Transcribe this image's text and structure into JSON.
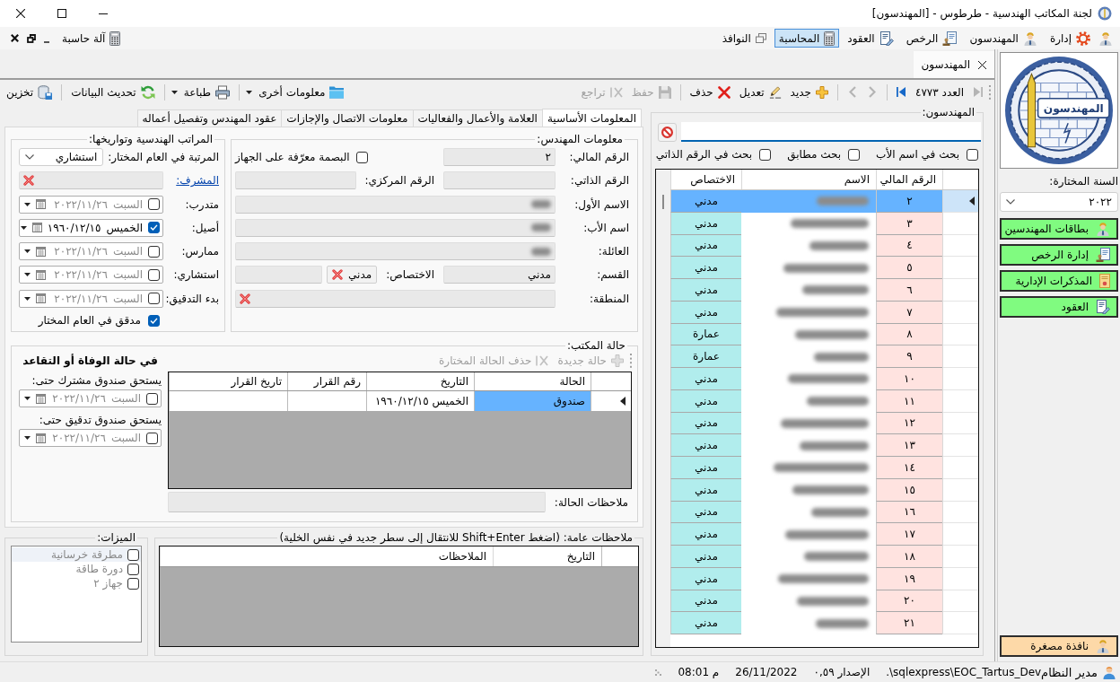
{
  "window": {
    "title": "لجنة المكاتب الهندسية - طرطوس - [المهندسون]"
  },
  "menu": {
    "items": [
      {
        "kind": "admin",
        "label": "إدارة",
        "selected": false
      },
      {
        "kind": "engineers",
        "label": "المهندسون",
        "selected": false
      },
      {
        "kind": "licenses",
        "label": "الرخص",
        "selected": false
      },
      {
        "kind": "contracts",
        "label": "العقود",
        "selected": false
      },
      {
        "kind": "accounting",
        "label": "المحاسبة",
        "selected": true
      },
      {
        "kind": "windows",
        "label": "النوافذ",
        "selected": false
      }
    ],
    "calculator": {
      "label": "آلة حاسبة"
    }
  },
  "document_tabs": [
    {
      "label": "المهندسون",
      "selected": true
    }
  ],
  "record_toolbar": {
    "first": {
      "disabled": true
    },
    "count": "العدد ٤٧٧٣",
    "last": {
      "disabled": false
    },
    "previous": {
      "disabled": true
    },
    "next": {
      "disabled": true
    },
    "action_groups": [
      [
        {
          "kind": "new",
          "label": "جديد",
          "disabled": false
        },
        {
          "kind": "edit",
          "label": "تعديل",
          "disabled": false
        },
        {
          "kind": "delete",
          "label": "حذف",
          "disabled": false
        }
      ],
      [
        {
          "kind": "save",
          "label": "حفظ",
          "disabled": true
        },
        {
          "kind": "undo",
          "label": "تراجع",
          "disabled": true
        }
      ]
    ]
  },
  "tools_toolbar": [
    {
      "kind": "other_info",
      "label": "معلومات أخرى",
      "dropdown": true
    },
    {
      "kind": "print",
      "label": "طباعة",
      "dropdown": true
    },
    {
      "kind": "refresh",
      "label": "تحديث البيانات",
      "dropdown": false
    },
    {
      "kind": "store",
      "label": "تخزين",
      "dropdown": false
    }
  ],
  "form_tabs": [
    {
      "label": "المعلومات الأساسية",
      "selected": true
    },
    {
      "label": "العلامة والأعمال والفعاليات",
      "selected": false
    },
    {
      "label": "معلومات الاتصال والإجازات",
      "selected": false
    },
    {
      "label": "عقود المهندس وتفصيل أعماله",
      "selected": false
    }
  ],
  "engineer_info": {
    "title": "معلومات المهندس:",
    "financial_number": {
      "label": "الرقم المالي:",
      "value": "٢"
    },
    "fingerprint": {
      "label": "البصمة معرّفة على الجهاز",
      "checked": false
    },
    "personal_number": {
      "label": "الرقم الذاتي:"
    },
    "central_number": {
      "label": "الرقم المركزي:"
    },
    "first_name": {
      "label": "الاسم الأول:",
      "blurred": true
    },
    "father_name": {
      "label": "اسم الأب:",
      "blurred": true
    },
    "family_name": {
      "label": "العائلة:",
      "blurred": true
    },
    "department": {
      "label": "القسم:",
      "value": "مدني"
    },
    "specialty": {
      "label": "الاختصاص:",
      "value": "مدني"
    },
    "region": {
      "label": "المنطقة:"
    }
  },
  "ranks": {
    "title": "المراتب الهندسية وتواريخها:",
    "rank": {
      "label": "المرتبة في العام المختار:",
      "value": "استشاري"
    },
    "supervisor": {
      "label": "المشرف:"
    },
    "dates": [
      {
        "label": "متدرب:",
        "checked": false,
        "day": "السبت",
        "date": "٢٠٢٢/١١/٢٦"
      },
      {
        "label": "أصيل:",
        "checked": true,
        "day": "الخميس",
        "date": "١٩٦٠/١٢/١٥"
      },
      {
        "label": "ممارس:",
        "checked": false,
        "day": "السبت",
        "date": "٢٠٢٢/١١/٢٦"
      },
      {
        "label": "استشاري:",
        "checked": false,
        "day": "السبت",
        "date": "٢٠٢٢/١١/٢٦"
      },
      {
        "label": "بدء التدقيق:",
        "checked": false,
        "day": "السبت",
        "date": "٢٠٢٢/١١/٢٦"
      }
    ],
    "auditor": {
      "label": "مدقق في العام المختار",
      "checked": true
    }
  },
  "office_status": {
    "title": "حالة المكتب:",
    "retirement_note": "في حالة الوفاة أو التقاعد",
    "funds": [
      {
        "label": "يستحق صندوق مشترك حتى:",
        "checked": false,
        "day": "السبت",
        "date": "٢٠٢٢/١١/٢٦"
      },
      {
        "label": "يستحق صندوق تدقيق حتى:",
        "checked": false,
        "day": "السبت",
        "date": "٢٠٢٢/١١/٢٦"
      }
    ],
    "toolbar": [
      {
        "kind": "add",
        "label": "حالة جديدة",
        "disabled": true
      },
      {
        "kind": "delete",
        "label": "حذف الحالة المختارة",
        "disabled": true
      }
    ],
    "table": {
      "columns": [
        "الحالة",
        "التاريخ",
        "رقم القرار",
        "تاريخ القرار"
      ],
      "rows": [
        {
          "status": "صندوق",
          "date": "الخميس ١٩٦٠/١٢/١٥",
          "selected": true
        }
      ]
    },
    "notes": {
      "label": "ملاحظات الحالة:"
    }
  },
  "features": {
    "title": "الميزات:",
    "items": [
      {
        "label": "مطرقة خرسانية",
        "checked": false,
        "selected": true,
        "disabled": true
      },
      {
        "label": "دورة طاقة",
        "checked": false,
        "selected": false,
        "disabled": true
      },
      {
        "label": "جهاز ٢",
        "checked": false,
        "selected": false,
        "disabled": true
      }
    ]
  },
  "general_notes": {
    "title": "ملاحظات عامة: (اضغط Shift+Enter للانتقال إلى سطر جديد في نفس الخلية)",
    "columns": [
      "التاريخ",
      "الملاحظات"
    ]
  },
  "engineers": {
    "title": "المهندسون:",
    "options": [
      {
        "label": "بحث في اسم الأب",
        "checked": false
      },
      {
        "label": "بحث مطابق",
        "checked": false
      },
      {
        "label": "بحث في الرقم الذاتي",
        "checked": false
      }
    ],
    "table": {
      "columns": [
        {
          "label": "الرقم المالي"
        },
        {
          "label": "الاسم",
          "blurred": true
        },
        {
          "label": "الاختصاص"
        }
      ],
      "rows": [
        {
          "number": "٢",
          "specialty": "مدني",
          "selected": true
        },
        {
          "number": "٣",
          "specialty": "مدني",
          "selected": false
        },
        {
          "number": "٤",
          "specialty": "مدني",
          "selected": false
        },
        {
          "number": "٥",
          "specialty": "مدني",
          "selected": false
        },
        {
          "number": "٦",
          "specialty": "مدني",
          "selected": false
        },
        {
          "number": "٧",
          "specialty": "مدني",
          "selected": false
        },
        {
          "number": "٨",
          "specialty": "عمارة",
          "selected": false
        },
        {
          "number": "٩",
          "specialty": "عمارة",
          "selected": false
        },
        {
          "number": "١٠",
          "specialty": "مدني",
          "selected": false
        },
        {
          "number": "١١",
          "specialty": "مدني",
          "selected": false
        },
        {
          "number": "١٢",
          "specialty": "مدني",
          "selected": false
        },
        {
          "number": "١٣",
          "specialty": "مدني",
          "selected": false
        },
        {
          "number": "١٤",
          "specialty": "مدني",
          "selected": false
        },
        {
          "number": "١٥",
          "specialty": "مدني",
          "selected": false
        },
        {
          "number": "١٦",
          "specialty": "مدني",
          "selected": false
        },
        {
          "number": "١٧",
          "specialty": "مدني",
          "selected": false
        },
        {
          "number": "١٨",
          "specialty": "مدني",
          "selected": false
        },
        {
          "number": "١٩",
          "specialty": "مدني",
          "selected": false
        },
        {
          "number": "٢٠",
          "specialty": "مدني",
          "selected": false
        },
        {
          "number": "٢١",
          "specialty": "مدني",
          "selected": false
        }
      ]
    }
  },
  "sidebar": {
    "logo": {
      "text": "المهندسون"
    },
    "year": {
      "label": "السنة المختارة:",
      "value": "٢٠٢٢"
    },
    "buttons": [
      {
        "kind": "engineer",
        "label": "بطاقات المهندسين"
      },
      {
        "kind": "license",
        "label": "إدارة الرخص"
      },
      {
        "kind": "memo",
        "label": "المذكرات الإدارية"
      },
      {
        "kind": "contract",
        "label": "العقود"
      }
    ],
    "mini_window": {
      "label": "نافذة مصغرة"
    }
  },
  "status_bar": {
    "user": "مدير النظام",
    "time": "08:01 م",
    "date": "26/11/2022",
    "version": "الإصدار ٠,٥٩",
    "database": ".\\sqlexpress\\EOC_Tartus_Dev"
  }
}
